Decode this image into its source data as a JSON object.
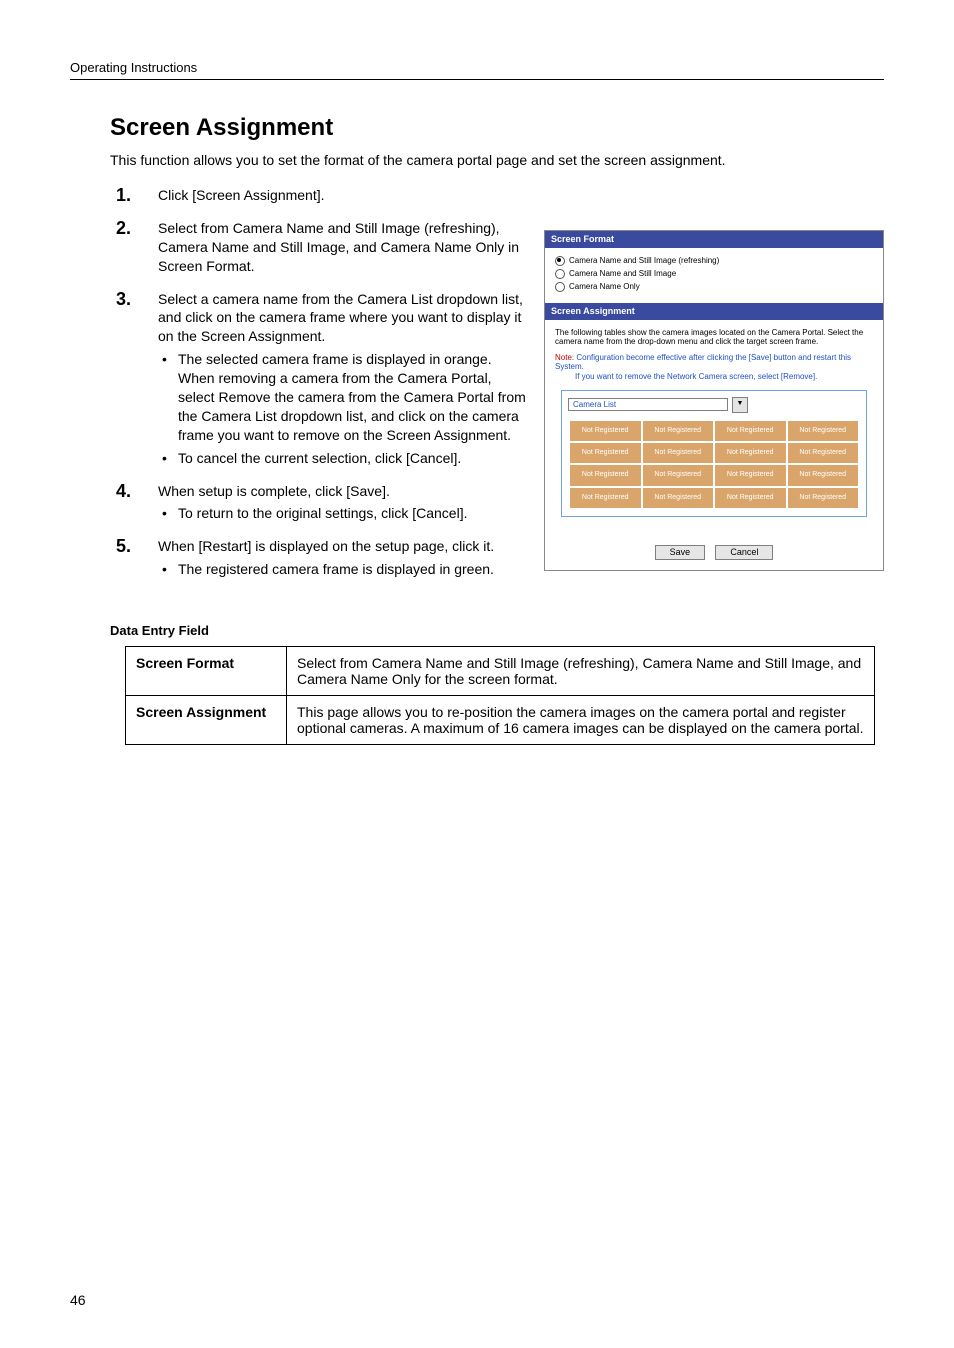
{
  "running_head": "Operating Instructions",
  "title": "Screen Assignment",
  "intro": "This function allows you to set the format of the camera portal page and set the screen assignment.",
  "steps": [
    {
      "text": "Click [Screen Assignment]."
    },
    {
      "text": "Select from Camera Name and Still Image (refreshing), Camera Name and Still Image, and Camera Name Only in Screen Format."
    },
    {
      "text": "Select a camera name from the Camera List dropdown list, and click on the camera frame where you want to display it on the Screen Assignment.",
      "sub": [
        "The selected camera frame is displayed in orange. When removing a camera from the Camera Portal, select Remove the camera from the Camera Portal from the Camera List dropdown list, and click on the camera frame you want to remove on the Screen Assignment.",
        "To cancel the current selection, click [Cancel]."
      ]
    },
    {
      "text": "When setup is complete, click [Save].",
      "sub": [
        "To return to the original settings, click [Cancel]."
      ]
    },
    {
      "text": "When [Restart] is displayed on the setup page, click it.",
      "sub": [
        "The registered camera frame is displayed in green."
      ]
    }
  ],
  "data_entry_heading": "Data Entry Field",
  "fields": [
    {
      "name": "Screen Format",
      "desc": "Select from Camera Name and Still Image (refreshing), Camera Name and Still Image, and Camera Name Only for the screen format."
    },
    {
      "name": "Screen Assignment",
      "desc": "This page allows you to re-position the camera images on the camera portal and register optional cameras. A maximum of 16 camera images can be displayed on the camera portal."
    }
  ],
  "shot": {
    "bar1": "Screen Format",
    "radios": [
      "Camera Name and Still Image (refreshing)",
      "Camera Name and Still Image",
      "Camera Name Only"
    ],
    "bar2": "Screen Assignment",
    "desc": "The following tables show the camera images located on the Camera Portal. Select the camera name from the drop-down menu and click the target screen frame.",
    "note_label": "Note",
    "note_text1": ": Configuration become effective after clicking the [Save] button and restart this System.",
    "note_text2": "If you want to remove the Network Camera screen, select [Remove].",
    "camlist_label": "Camera List",
    "cell": "Not Registered",
    "save": "Save",
    "cancel": "Cancel"
  },
  "page_number": "46"
}
